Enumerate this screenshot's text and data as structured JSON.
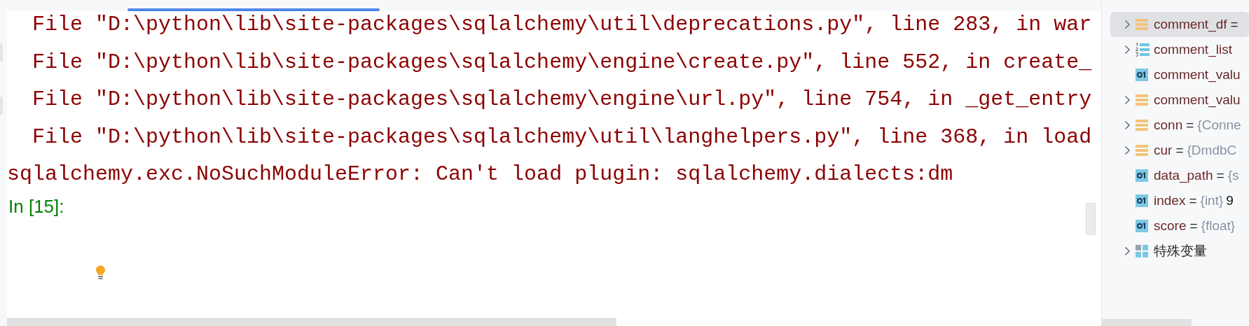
{
  "traceback": {
    "frames": [
      "  File \"D:\\python\\lib\\site-packages\\sqlalchemy\\util\\deprecations.py\", line 283, in war",
      "  File \"D:\\python\\lib\\site-packages\\sqlalchemy\\engine\\create.py\", line 552, in create_",
      "  File \"D:\\python\\lib\\site-packages\\sqlalchemy\\engine\\url.py\", line 754, in _get_entry",
      "  File \"D:\\python\\lib\\site-packages\\sqlalchemy\\util\\langhelpers.py\", line 368, in load"
    ],
    "error": "sqlalchemy.exc.NoSuchModuleError: Can't load plugin: sqlalchemy.dialects:dm"
  },
  "prompt": "In [15]:",
  "variables": [
    {
      "name": "comment_df",
      "operator": "=",
      "kind": "table",
      "expandable": true,
      "selected": true
    },
    {
      "name": "comment_list",
      "kind": "list",
      "expandable": true,
      "selected": false
    },
    {
      "name": "comment_valu",
      "kind": "scalar",
      "expandable": false,
      "selected": false
    },
    {
      "name": "comment_valu",
      "kind": "table",
      "expandable": true,
      "selected": false
    },
    {
      "name": "conn",
      "operator": "=",
      "type": "{Conne",
      "kind": "table",
      "expandable": true,
      "selected": false
    },
    {
      "name": "cur",
      "operator": "=",
      "type": "{DmdbC",
      "kind": "table",
      "expandable": true,
      "selected": false
    },
    {
      "name": "data_path",
      "operator": "=",
      "type": "{s",
      "kind": "scalar",
      "expandable": false,
      "selected": false
    },
    {
      "name": "index",
      "operator": "=",
      "type": "{int}",
      "value": "9",
      "kind": "scalar",
      "expandable": false,
      "selected": false
    },
    {
      "name": "score",
      "operator": "=",
      "type": "{float}",
      "kind": "scalar",
      "expandable": false,
      "selected": false
    },
    {
      "name": "特殊变量",
      "kind": "group",
      "expandable": true,
      "selected": false
    }
  ]
}
